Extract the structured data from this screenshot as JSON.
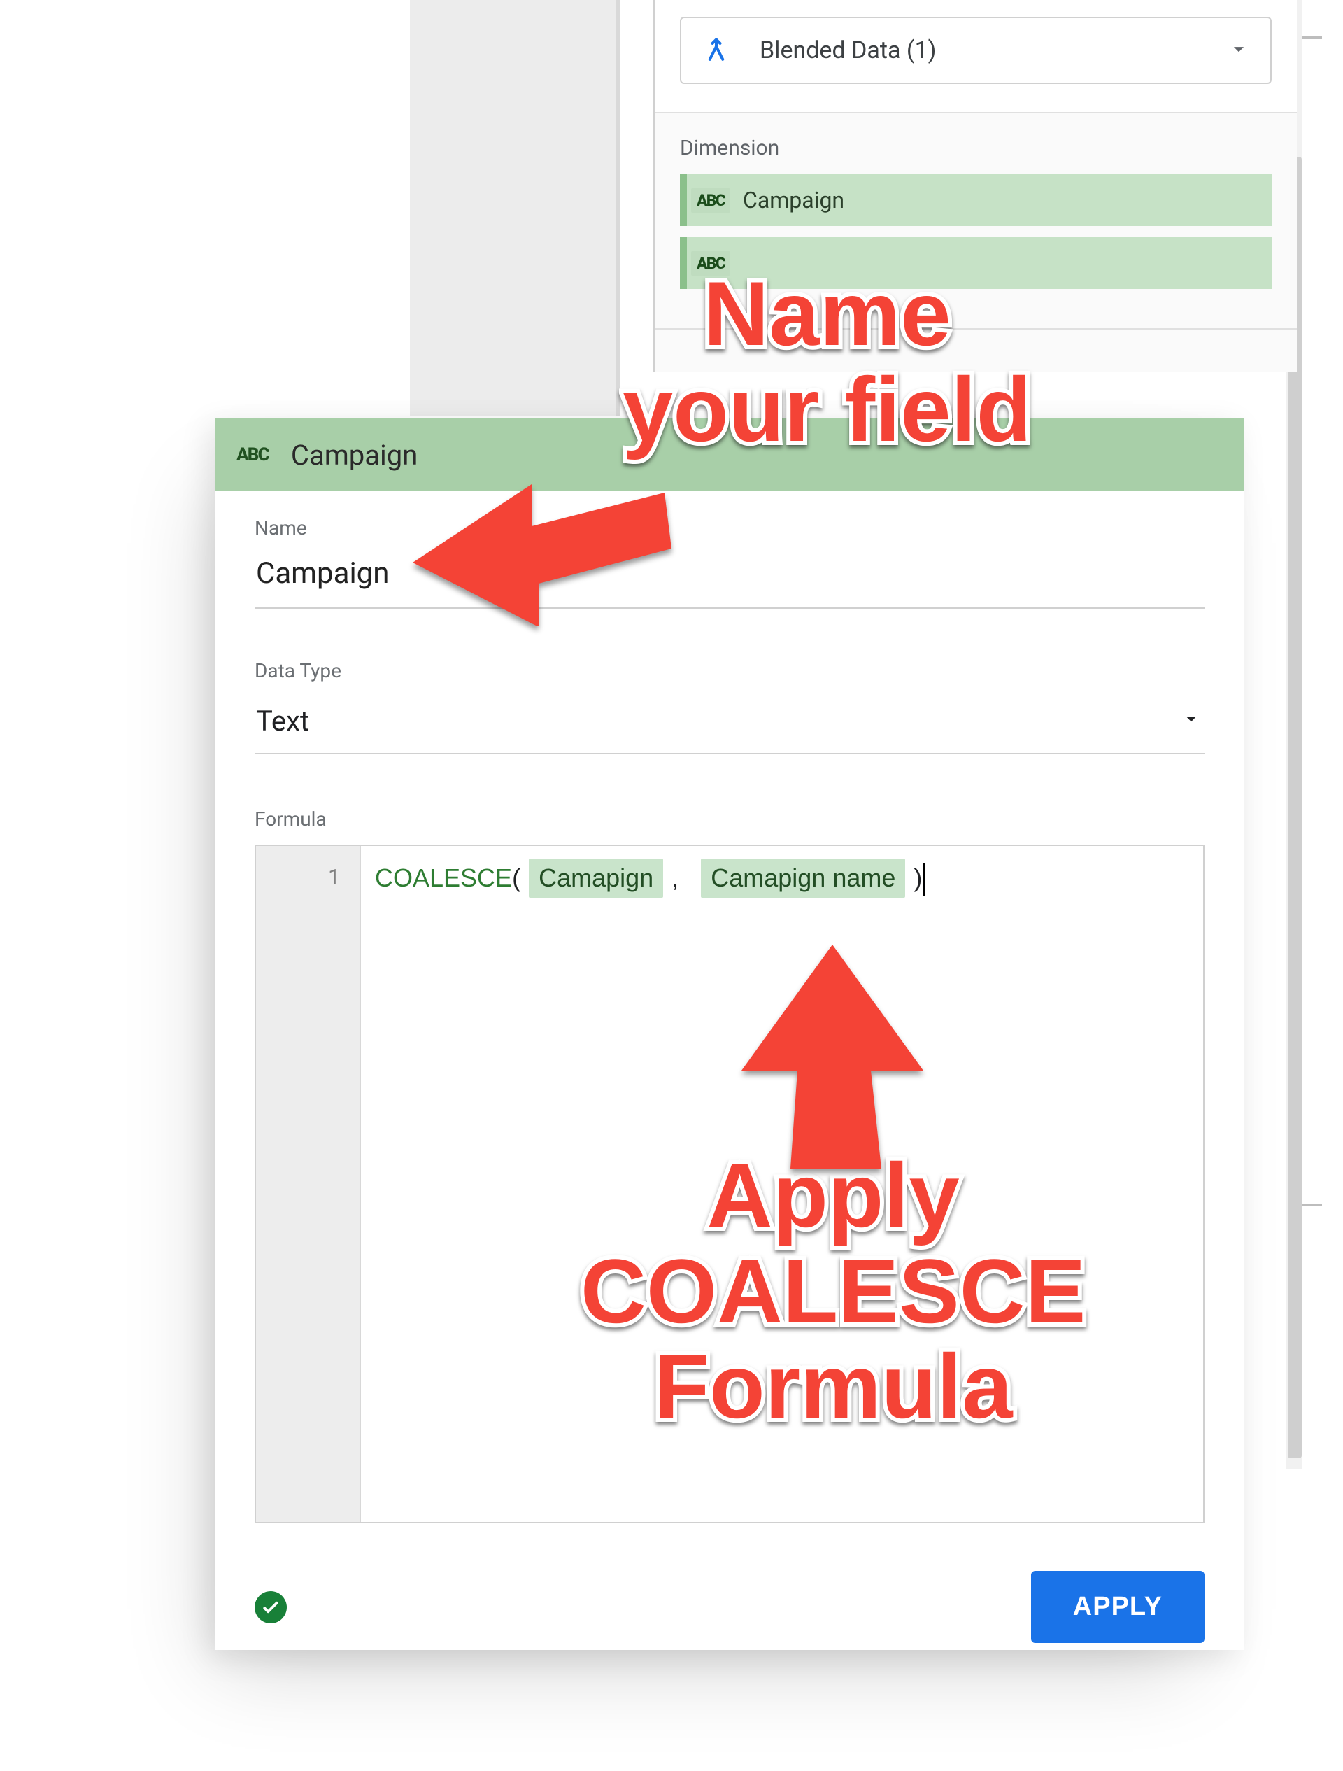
{
  "props": {
    "data_source_label": "Blended Data (1)",
    "dimension_title": "Dimension",
    "fields": [
      {
        "type_badge": "ABC",
        "label": "Campaign"
      },
      {
        "type_badge": "ABC",
        "label": ""
      }
    ]
  },
  "editor": {
    "header_type_badge": "ABC",
    "header_title": "Campaign",
    "name_label": "Name",
    "name_value": "Campaign",
    "type_label": "Data Type",
    "type_value": "Text",
    "formula_label": "Formula",
    "formula": {
      "line_no": "1",
      "fn": "COALESCE",
      "open": "(",
      "arg1": "Camapign",
      "sep": ",",
      "arg2": "Camapign name",
      "close": ")"
    },
    "apply_label": "APPLY"
  },
  "annotations": {
    "name_field": "Name\nyour field",
    "formula": "Apply\nCOALESCE\nFormula"
  }
}
